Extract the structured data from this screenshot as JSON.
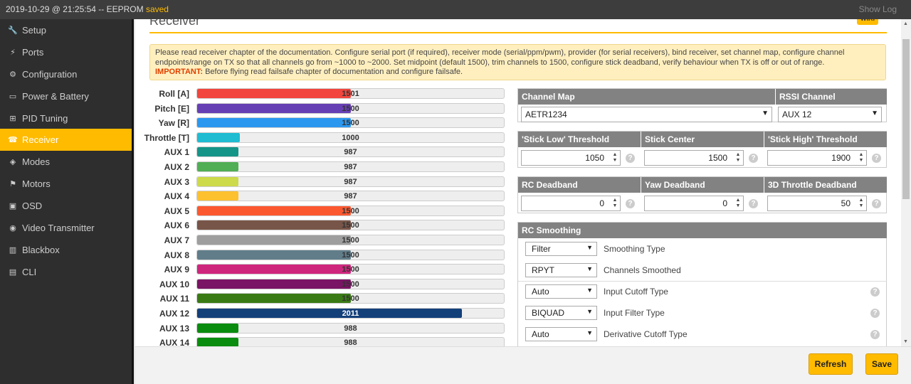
{
  "topbar": {
    "status": "2019-10-29 @ 21:25:54 -- EEPROM ",
    "status_saved": "saved",
    "show_log": "Show Log"
  },
  "sidebar": {
    "items": [
      {
        "label": "Setup",
        "icon": "wrench-icon",
        "active": false
      },
      {
        "label": "Ports",
        "icon": "plug-icon",
        "active": false
      },
      {
        "label": "Configuration",
        "icon": "gear-icon",
        "active": false
      },
      {
        "label": "Power & Battery",
        "icon": "battery-icon",
        "active": false
      },
      {
        "label": "PID Tuning",
        "icon": "pid-icon",
        "active": false
      },
      {
        "label": "Receiver",
        "icon": "receiver-icon",
        "active": true
      },
      {
        "label": "Modes",
        "icon": "toggles-icon",
        "active": false
      },
      {
        "label": "Motors",
        "icon": "motor-icon",
        "active": false
      },
      {
        "label": "OSD",
        "icon": "osd-icon",
        "active": false
      },
      {
        "label": "Video Transmitter",
        "icon": "antenna-icon",
        "active": false
      },
      {
        "label": "Blackbox",
        "icon": "blackbox-icon",
        "active": false
      },
      {
        "label": "CLI",
        "icon": "terminal-icon",
        "active": false
      }
    ]
  },
  "page": {
    "title": "Receiver",
    "wiki": "WIKI",
    "note_text": "Please read receiver chapter of the documentation. Configure serial port (if required), receiver mode (serial/ppm/pwm), provider (for serial receivers), bind receiver, set channel map, configure channel endpoints/range on TX so that all channels go from ~1000 to ~2000. Set midpoint (default 1500), trim channels to 1500, configure stick deadband, verify behaviour when TX is off or out of range.",
    "note_important": "IMPORTANT:",
    "note_important_text": " Before flying read failsafe chapter of documentation and configure failsafe."
  },
  "channels": [
    {
      "label": "Roll [A]",
      "value": "1501",
      "level": 0.5,
      "color": "#f1453d"
    },
    {
      "label": "Pitch [E]",
      "value": "1500",
      "level": 0.5,
      "color": "#673fb4"
    },
    {
      "label": "Yaw [R]",
      "value": "1500",
      "level": 0.5,
      "color": "#2b98f0"
    },
    {
      "label": "Throttle [T]",
      "value": "1000",
      "level": 0.14,
      "color": "#1fbcd2"
    },
    {
      "label": "AUX 1",
      "value": "987",
      "level": 0.135,
      "color": "#159588"
    },
    {
      "label": "AUX 2",
      "value": "987",
      "level": 0.135,
      "color": "#50ae55"
    },
    {
      "label": "AUX 3",
      "value": "987",
      "level": 0.135,
      "color": "#cdda49"
    },
    {
      "label": "AUX 4",
      "value": "987",
      "level": 0.135,
      "color": "#fdc02f"
    },
    {
      "label": "AUX 5",
      "value": "1500",
      "level": 0.5,
      "color": "#fc5830"
    },
    {
      "label": "AUX 6",
      "value": "1500",
      "level": 0.5,
      "color": "#785549"
    },
    {
      "label": "AUX 7",
      "value": "1500",
      "level": 0.5,
      "color": "#9e9e9e"
    },
    {
      "label": "AUX 8",
      "value": "1500",
      "level": 0.5,
      "color": "#617d8a"
    },
    {
      "label": "AUX 9",
      "value": "1500",
      "level": 0.5,
      "color": "#cf267d"
    },
    {
      "label": "AUX 10",
      "value": "1500",
      "level": 0.5,
      "color": "#7a1464"
    },
    {
      "label": "AUX 11",
      "value": "1500",
      "level": 0.5,
      "color": "#3a7a14"
    },
    {
      "label": "AUX 12",
      "value": "2011",
      "level": 0.862,
      "color": "#14407a"
    },
    {
      "label": "AUX 13",
      "value": "988",
      "level": 0.135,
      "color": "#0a8c0e"
    },
    {
      "label": "AUX 14",
      "value": "988",
      "level": 0.135,
      "color": "#0a8c0e"
    }
  ],
  "channel_map": {
    "header": "Channel Map",
    "value": "AETR1234"
  },
  "rssi": {
    "header": "RSSI Channel",
    "value": "AUX 12"
  },
  "thresholds": {
    "low_header": "'Stick Low' Threshold",
    "low_value": "1050",
    "center_header": "Stick Center",
    "center_value": "1500",
    "high_header": "'Stick High' Threshold",
    "high_value": "1900"
  },
  "deadbands": {
    "rc_header": "RC Deadband",
    "rc_value": "0",
    "yaw_header": "Yaw Deadband",
    "yaw_value": "0",
    "throttle_header": "3D Throttle Deadband",
    "throttle_value": "50"
  },
  "smoothing": {
    "header": "RC Smoothing",
    "rows": [
      {
        "select": "Filter",
        "label": "Smoothing Type",
        "help": false
      },
      {
        "select": "RPYT",
        "label": "Channels Smoothed",
        "help": false
      },
      {
        "select": "Auto",
        "label": "Input Cutoff Type",
        "help": true
      },
      {
        "select": "BIQUAD",
        "label": "Input Filter Type",
        "help": true
      },
      {
        "select": "Auto",
        "label": "Derivative Cutoff Type",
        "help": true
      }
    ]
  },
  "buttons": {
    "refresh": "Refresh",
    "save": "Save"
  }
}
